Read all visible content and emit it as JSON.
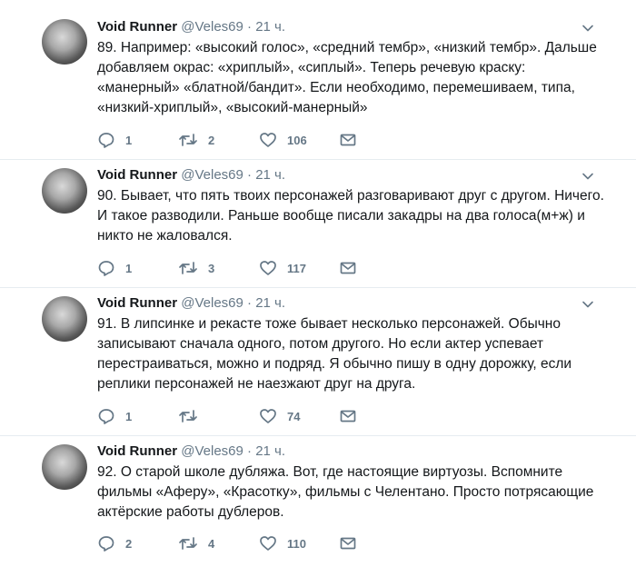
{
  "colors": {
    "text": "#14171a",
    "muted": "#657786",
    "divider": "#e6ecf0"
  },
  "icons": [
    "reply-icon",
    "retweet-icon",
    "like-icon",
    "dm-icon",
    "chevron-down-icon"
  ],
  "tweets": [
    {
      "name": "Void Runner",
      "handle": "@Veles69",
      "dot": "·",
      "time": "21 ч.",
      "text": "89. Например: «высокий голос», «средний тембр», «низкий тембр». Дальше добавляем окрас: «хриплый», «сиплый». Теперь речевую краску: «манерный» «блатной/бандит». Если необходимо, перемешиваем, типа, «низкий-хриплый», «высокий-манерный»",
      "replies": "1",
      "retweets": "2",
      "likes": "106"
    },
    {
      "name": "Void Runner",
      "handle": "@Veles69",
      "dot": "·",
      "time": "21 ч.",
      "text": "90. Бывает, что пять твоих персонажей разговаривают друг с другом. Ничего. И такое разводили. Раньше вообще писали закадры на два голоса(м+ж) и никто не жаловался.",
      "replies": "1",
      "retweets": "3",
      "likes": "117"
    },
    {
      "name": "Void Runner",
      "handle": "@Veles69",
      "dot": "·",
      "time": "21 ч.",
      "text": "91. В липсинке и рекасте тоже бывает несколько персонажей. Обычно записывают сначала одного, потом другого. Но если актер успевает перестраиваться, можно и подряд. Я обычно пишу в одну дорожку, если реплики персонажей не наезжают друг на друга.",
      "replies": "1",
      "retweets": "",
      "likes": "74"
    },
    {
      "name": "Void Runner",
      "handle": "@Veles69",
      "dot": "·",
      "time": "21 ч.",
      "text": "92. О старой школе дубляжа. Вот, где настоящие виртуозы. Вспомните фильмы «Аферу», «Красотку», фильмы с Челентано. Просто потрясающие актёрские работы дублеров.",
      "replies": "2",
      "retweets": "4",
      "likes": "110"
    }
  ]
}
